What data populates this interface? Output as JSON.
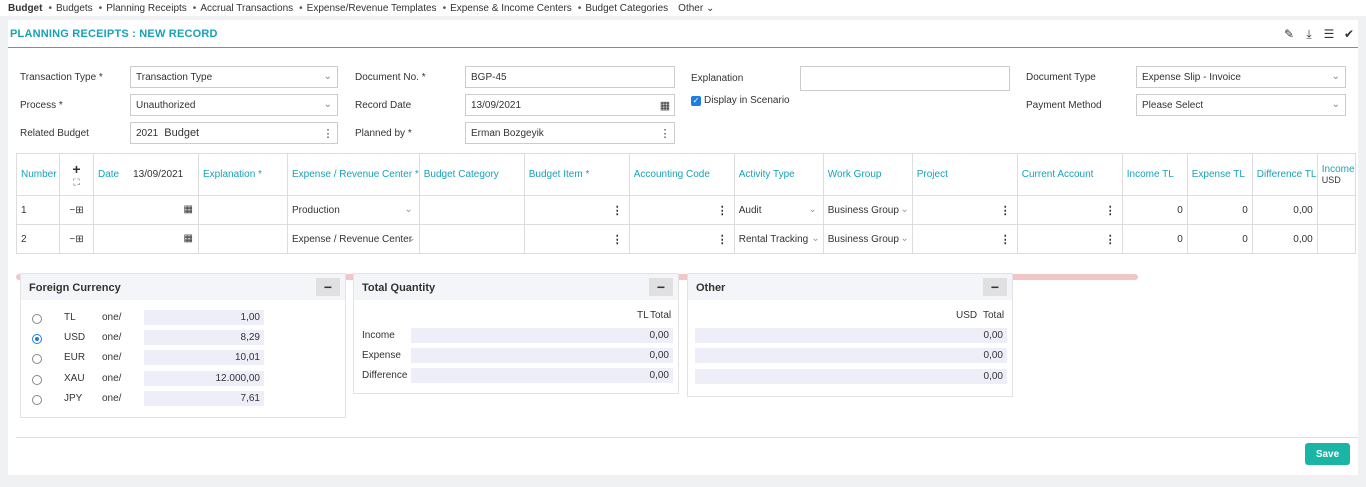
{
  "nav": {
    "items": [
      "Budget",
      "Budgets",
      "Planning Receipts",
      "Accrual Transactions",
      "Expense/Revenue Templates",
      "Expense & Income Centers",
      "Budget Categories",
      "Other"
    ]
  },
  "page": {
    "title": "PLANNING RECEIPTS : NEW RECORD"
  },
  "form": {
    "transaction_type_label": "Transaction Type *",
    "transaction_type_value": "Transaction Type",
    "process_label": "Process *",
    "process_value": "Unauthorized",
    "related_budget_label": "Related Budget",
    "related_budget_year": "2021",
    "related_budget_value": "Budget",
    "document_no_label": "Document No. *",
    "document_no_value": "BGP-45",
    "record_date_label": "Record Date",
    "record_date_value": "13/09/2021",
    "planned_by_label": "Planned by *",
    "planned_by_value": "Erman Bozgeyik",
    "explanation_label": "Explanation",
    "explanation_value": "",
    "display_in_scenario_label": "Display in Scenario",
    "document_type_label": "Document Type",
    "document_type_value": "Expense Slip - Invoice",
    "payment_method_label": "Payment Method",
    "payment_method_value": "Please Select"
  },
  "grid": {
    "headers": {
      "number": "Number",
      "date": "Date",
      "date_value": "13/09/2021",
      "explanation": "Explanation *",
      "center": "Expense / Revenue Center *",
      "category": "Budget Category",
      "item": "Budget Item *",
      "accounting": "Accounting Code",
      "activity": "Activity Type",
      "workgroup": "Work Group",
      "project": "Project",
      "account": "Current Account",
      "income": "Income TL",
      "expense": "Expense TL",
      "difference": "Difference TL",
      "income_usd": "Income",
      "income_usd_sub": "USD"
    },
    "rows": [
      {
        "number": "1",
        "center": "Production",
        "activity": "Audit",
        "workgroup": "Business Group",
        "income": "0",
        "expense": "0",
        "difference": "0,00"
      },
      {
        "number": "2",
        "center": "Expense / Revenue Center",
        "activity": "Rental Tracking",
        "workgroup": "Business Group",
        "income": "0",
        "expense": "0",
        "difference": "0,00"
      }
    ]
  },
  "foreign_currency": {
    "title": "Foreign Currency",
    "rows": [
      {
        "code": "TL",
        "unit": "one/",
        "rate": "1,00"
      },
      {
        "code": "USD",
        "unit": "one/",
        "rate": "8,29"
      },
      {
        "code": "EUR",
        "unit": "one/",
        "rate": "10,01"
      },
      {
        "code": "XAU",
        "unit": "one/",
        "rate": "12.000,00"
      },
      {
        "code": "JPY",
        "unit": "one/",
        "rate": "7,61"
      }
    ],
    "selected": "USD"
  },
  "total_quantity": {
    "title": "Total Quantity",
    "col_currency": "TL",
    "col_total": "Total",
    "rows": [
      {
        "label": "Income",
        "value": "0,00"
      },
      {
        "label": "Expense",
        "value": "0,00"
      },
      {
        "label": "Difference",
        "value": "0,00"
      }
    ]
  },
  "other": {
    "title": "Other",
    "col_currency": "USD",
    "col_total": "Total",
    "values": [
      "0,00",
      "0,00",
      "0,00"
    ]
  },
  "actions": {
    "save_label": "Save"
  }
}
